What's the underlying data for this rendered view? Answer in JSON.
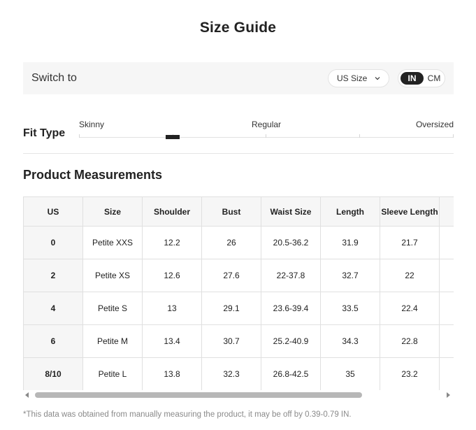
{
  "title": "Size Guide",
  "switch": {
    "label": "Switch to",
    "size_select": "US Size",
    "units": {
      "in": "IN",
      "cm": "CM",
      "selected": "IN"
    }
  },
  "fit_type": {
    "label": "Fit Type",
    "options": [
      "Skinny",
      "Regular",
      "Oversized"
    ],
    "indicator_fraction": 0.25
  },
  "measurements": {
    "title": "Product Measurements",
    "headers": [
      "US",
      "Size",
      "Shoulder",
      "Bust",
      "Waist Size",
      "Length",
      "Sleeve Length",
      ""
    ],
    "rows": [
      [
        "0",
        "Petite XXS",
        "12.2",
        "26",
        "20.5-36.2",
        "31.9",
        "21.7",
        ""
      ],
      [
        "2",
        "Petite XS",
        "12.6",
        "27.6",
        "22-37.8",
        "32.7",
        "22",
        ""
      ],
      [
        "4",
        "Petite S",
        "13",
        "29.1",
        "23.6-39.4",
        "33.5",
        "22.4",
        ""
      ],
      [
        "6",
        "Petite M",
        "13.4",
        "30.7",
        "25.2-40.9",
        "34.3",
        "22.8",
        ""
      ],
      [
        "8/10",
        "Petite L",
        "13.8",
        "32.3",
        "26.8-42.5",
        "35",
        "23.2",
        ""
      ]
    ]
  },
  "footnote": "*This data was obtained from manually measuring the product, it may be off by 0.39-0.79 IN.",
  "icons": {
    "select": "chevron-down-icon",
    "scroll_left": "arrow-left-icon",
    "scroll_right": "arrow-right-icon"
  },
  "colors": {
    "accent": "#222222",
    "panel": "#f6f6f6",
    "border": "#e0e0e0",
    "muted": "#8a8a8a"
  }
}
